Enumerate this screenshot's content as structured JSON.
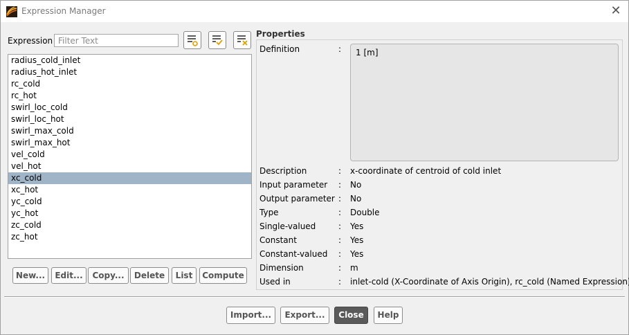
{
  "window": {
    "title": "Expression Manager"
  },
  "filter": {
    "label": "Expression",
    "placeholder": "Filter Text"
  },
  "expressions": [
    "radius_cold_inlet",
    "radius_hot_inlet",
    "rc_cold",
    "rc_hot",
    "swirl_loc_cold",
    "swirl_loc_hot",
    "swirl_max_cold",
    "swirl_max_hot",
    "vel_cold",
    "vel_hot",
    "xc_cold",
    "xc_hot",
    "yc_cold",
    "yc_hot",
    "zc_cold",
    "zc_hot"
  ],
  "selected_expression": "xc_cold",
  "list_buttons": {
    "new": "New...",
    "edit": "Edit...",
    "copy": "Copy...",
    "delete": "Delete",
    "list": "List",
    "compute": "Compute"
  },
  "properties": {
    "title": "Properties",
    "colon": ":",
    "definition_label": "Definition",
    "definition_value": "1 [m]",
    "rows": [
      {
        "label": "Description",
        "value": "x-coordinate of centroid of cold inlet"
      },
      {
        "label": "Input parameter",
        "value": "No"
      },
      {
        "label": "Output parameter",
        "value": "No"
      },
      {
        "label": "Type",
        "value": "Double"
      },
      {
        "label": "Single-valued",
        "value": "Yes"
      },
      {
        "label": "Constant",
        "value": "Yes"
      },
      {
        "label": "Constant-valued",
        "value": "Yes"
      },
      {
        "label": "Dimension",
        "value": "m"
      },
      {
        "label": "Used in",
        "value": "inlet-cold (X-Coordinate of Axis Origin), rc_cold (Named Expression)"
      }
    ]
  },
  "footer": {
    "import": "Import...",
    "export": "Export...",
    "close": "Close",
    "help": "Help"
  },
  "colors": {
    "selection": "#a0b4c8",
    "close_button": "#5a5a5a"
  }
}
